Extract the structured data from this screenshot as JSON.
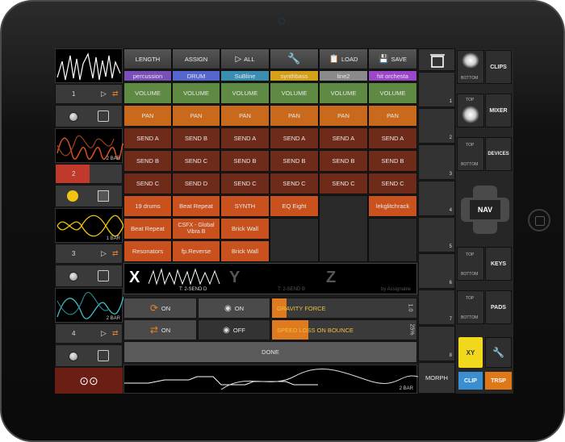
{
  "header": {
    "length": "LENGTH",
    "assign": "ASSIGN",
    "all": "ALL",
    "load": "LOAD",
    "save": "SAVE"
  },
  "tracks": [
    {
      "name": "percussion",
      "color": "#8a4fc2",
      "volume": "VOLUME",
      "pan": "PAN",
      "send_a": "SEND A",
      "send_b": "SEND B",
      "send_c": "SEND C",
      "devices": [
        "19 drums",
        "Beat Repeat",
        "Resonators"
      ]
    },
    {
      "name": "DRUM",
      "color": "#5566cc",
      "volume": "VOLUME",
      "pan": "PAN",
      "send_a": "SEND B",
      "send_b": "SEND C",
      "send_c": "SEND D",
      "devices": [
        "Beat Repeat",
        "CSFX - Global Vibra B",
        "fp.Reverse"
      ]
    },
    {
      "name": "SuBline",
      "color": "#3a8fb0",
      "volume": "VOLUME",
      "pan": "PAN",
      "send_a": "SEND A",
      "send_b": "SEND B",
      "send_c": "SEND C",
      "devices": [
        "SYNTH",
        "Brick Wall",
        "Brick Wall"
      ]
    },
    {
      "name": "synthbass",
      "color": "#d4a017",
      "volume": "VOLUME",
      "pan": "PAN",
      "send_a": "SEND A",
      "send_b": "SEND B",
      "send_c": "SEND C",
      "devices": [
        "EQ Eight"
      ]
    },
    {
      "name": "line2",
      "color": "#8a8a8a",
      "volume": "VOLUME",
      "pan": "PAN",
      "send_a": "SEND A",
      "send_b": "SEND B",
      "send_c": "SEND C",
      "devices": []
    },
    {
      "name": "hit orchesta",
      "color": "#9b47c9",
      "volume": "VOLUME",
      "pan": "PAN",
      "send_a": "SEND A",
      "send_b": "SEND B",
      "send_c": "SEND C",
      "devices": [
        "lekglitchrack"
      ]
    }
  ],
  "clips": [
    {
      "num": "1",
      "bars": ""
    },
    {
      "num": "2",
      "bars": "2 BAR"
    },
    {
      "num": "3",
      "bars": "1 BAR"
    },
    {
      "num": "4",
      "bars": "2 BAR"
    }
  ],
  "xy": {
    "x": "X",
    "y": "Y",
    "z": "Z",
    "x_label": "T: 2-SEND D",
    "y_label": "T: 2-SEND B",
    "z_label": "by Assignable"
  },
  "physics": {
    "on1": "ON",
    "on2": "ON",
    "on3": "ON",
    "off": "OFF",
    "gravity": "GRAVITY FORCE",
    "gravity_val": "1.0",
    "speed": "SPEED LOSS ON BOUNCE",
    "speed_val": "25%",
    "done": "DONE"
  },
  "bottom": {
    "bars": "2 BAR",
    "morph": "MORPH"
  },
  "scenes": [
    "1",
    "2",
    "3",
    "4",
    "5",
    "6",
    "7",
    "8"
  ],
  "side": {
    "clips": "CLIPS",
    "mixer": "MIXER",
    "devices": "DEVICES",
    "nav": "NAV",
    "keys": "KEYS",
    "pads": "PADS",
    "top": "TOP",
    "bottom": "BOTTOM",
    "xy": "XY",
    "clip": "CLIP",
    "trsp": "TRSP"
  }
}
